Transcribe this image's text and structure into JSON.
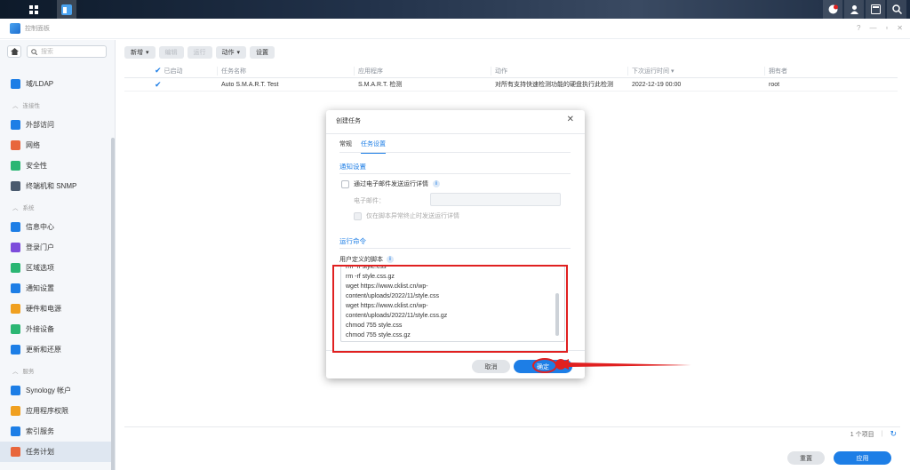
{
  "window": {
    "title": "控制面板",
    "controls": [
      "?",
      "—",
      "▫",
      "✕"
    ]
  },
  "sidebar": {
    "search_placeholder": "搜索",
    "items": [
      {
        "type": "item",
        "label": "域/LDAP",
        "icon": "ldap-icon",
        "color": "#1d7ee6"
      },
      {
        "type": "section",
        "label": "连接性"
      },
      {
        "type": "item",
        "label": "外部访问",
        "icon": "external-access-icon",
        "color": "#1d7ee6"
      },
      {
        "type": "item",
        "label": "网络",
        "icon": "network-icon",
        "color": "#e8663c"
      },
      {
        "type": "item",
        "label": "安全性",
        "icon": "security-shield-icon",
        "color": "#2bb673"
      },
      {
        "type": "item",
        "label": "终端机和 SNMP",
        "icon": "terminal-icon",
        "color": "#4a5a6e"
      },
      {
        "type": "section",
        "label": "系统"
      },
      {
        "type": "item",
        "label": "信息中心",
        "icon": "info-center-icon",
        "color": "#1d7ee6"
      },
      {
        "type": "item",
        "label": "登录门户",
        "icon": "login-portal-icon",
        "color": "#7d4cdb"
      },
      {
        "type": "item",
        "label": "区域选项",
        "icon": "regional-options-icon",
        "color": "#2bb673"
      },
      {
        "type": "item",
        "label": "通知设置",
        "icon": "notification-icon",
        "color": "#1d7ee6"
      },
      {
        "type": "item",
        "label": "硬件和电源",
        "icon": "hardware-power-icon",
        "color": "#f0a020"
      },
      {
        "type": "item",
        "label": "外接设备",
        "icon": "external-devices-icon",
        "color": "#2bb673"
      },
      {
        "type": "item",
        "label": "更新和还原",
        "icon": "update-restore-icon",
        "color": "#1d7ee6"
      },
      {
        "type": "section",
        "label": "服务"
      },
      {
        "type": "item",
        "label": "Synology 帐户",
        "icon": "synology-account-icon",
        "color": "#1d7ee6"
      },
      {
        "type": "item",
        "label": "应用程序权限",
        "icon": "app-privileges-icon",
        "color": "#f0a020"
      },
      {
        "type": "item",
        "label": "索引服务",
        "icon": "indexing-service-icon",
        "color": "#1d7ee6"
      },
      {
        "type": "item",
        "label": "任务计划",
        "icon": "task-scheduler-icon",
        "color": "#e8663c",
        "active": true
      }
    ]
  },
  "toolbar": {
    "create": "新增",
    "edit": "编辑",
    "run": "运行",
    "action": "动作",
    "settings": "设置"
  },
  "table": {
    "columns": [
      "已启动",
      "任务名称",
      "应用程序",
      "动作",
      "下次运行时间",
      "拥有者"
    ],
    "rows": [
      {
        "enabled": "✔",
        "name": "Auto S.M.A.R.T. Test",
        "app": "S.M.A.R.T. 检测",
        "action": "对所有支持快速检测功能的硬盘执行此检测",
        "next_run": "2022-12-19 00:00",
        "owner": "root"
      }
    ]
  },
  "footer": {
    "count": "1 个项目",
    "reset": "重置",
    "apply": "应用"
  },
  "dialog": {
    "title": "创建任务",
    "tabs": [
      "常规",
      "任务设置"
    ],
    "notify_header": "通知设置",
    "email_checkbox": "通过电子邮件发送运行详情",
    "email_label": "电子邮件：",
    "abnormal_checkbox": "仅在脚本异常终止时发送运行详情",
    "run_header": "运行命令",
    "script_label": "用户定义的脚本",
    "script_lines": [
      "rm -rf style.css",
      "rm -rf style.css.gz",
      "wget https://www.cklist.cn/wp-",
      "content/uploads/2022/11/style.css",
      "wget https://www.cklist.cn/wp-",
      "content/uploads/2022/11/style.css.gz",
      "chmod 755 style.css",
      "chmod 755 style.css.gz"
    ],
    "cancel": "取消",
    "ok": "确定"
  },
  "colors": {
    "accent": "#1d7ee6",
    "annotation": "#e02020"
  }
}
